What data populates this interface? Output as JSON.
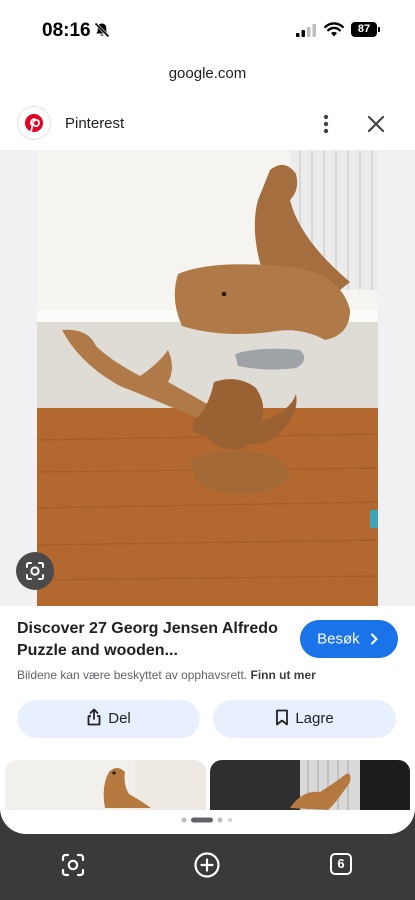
{
  "status_bar": {
    "time": "08:16",
    "battery": "87"
  },
  "browser": {
    "url": "google.com",
    "tab_count": "6"
  },
  "result": {
    "site_name": "Pinterest",
    "title": "Discover 27 Georg Jensen Alfredo Puzzle and wooden...",
    "visit_label": "Besøk",
    "copyright_text": "Bildene kan være beskyttet av opphavsrett.",
    "learn_more": "Finn ut mer",
    "share_label": "Del",
    "save_label": "Lagre"
  },
  "icons": [
    "bell-slash-icon",
    "signal-icon",
    "wifi-icon",
    "pinterest-logo",
    "more-vert-icon",
    "close-icon",
    "lens-icon",
    "share-icon",
    "bookmark-icon",
    "chevron-right-icon",
    "plus-icon",
    "tabs-icon"
  ],
  "colors": {
    "accent": "#1a73e8",
    "pinterest": "#e60023",
    "pill_bg": "#e8f0fe",
    "chrome_dark": "#3a3a3c"
  }
}
